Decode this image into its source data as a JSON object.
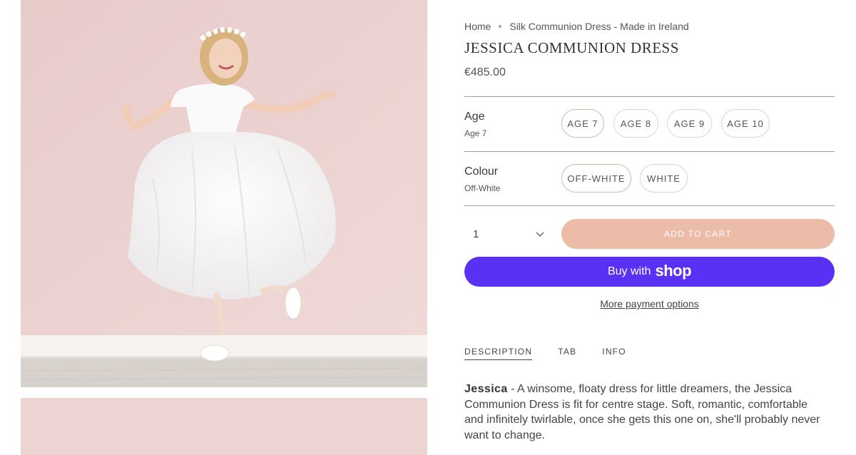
{
  "breadcrumb": {
    "home": "Home",
    "current": "Silk Communion Dress - Made in Ireland"
  },
  "product": {
    "title": "JESSICA COMMUNION DRESS",
    "price": "€485.00"
  },
  "options": {
    "age": {
      "label": "Age",
      "selected": "Age 7",
      "choices": [
        "AGE 7",
        "AGE 8",
        "AGE 9",
        "AGE 10"
      ]
    },
    "colour": {
      "label": "Colour",
      "selected": "Off-White",
      "choices": [
        "OFF-WHITE",
        "WHITE"
      ]
    }
  },
  "purchase": {
    "quantity": "1",
    "add_to_cart": "ADD TO CART",
    "buy_with": "Buy with",
    "shop_brand": "shop",
    "more_payment": "More payment options"
  },
  "tabs": [
    "DESCRIPTION",
    "TAB",
    "INFO"
  ],
  "description": {
    "name": "Jessica",
    "text": " - A winsome, floaty dress for little dreamers, the Jessica Communion Dress is fit for centre stage. Soft, romantic, comfortable and infinitely twirlable, once she gets this one on, she'll probably never want to change."
  },
  "colors": {
    "add_to_cart_bg": "#ecbca9",
    "shop_pay_bg": "#5a31f4",
    "photo_wall": "#ecd3d1",
    "photo_floor": "#d6d0cb"
  }
}
